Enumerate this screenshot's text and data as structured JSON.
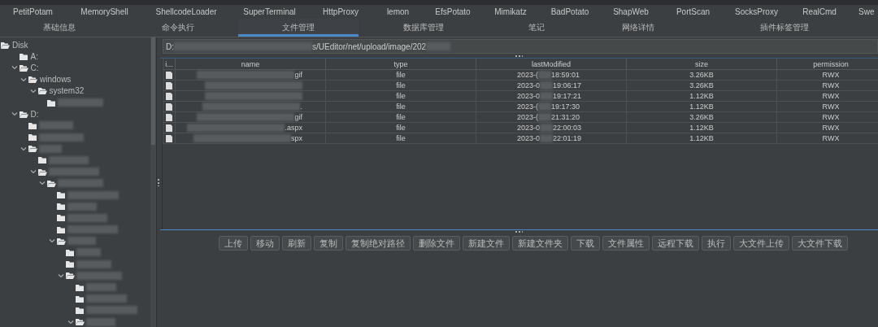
{
  "plugin_menu": [
    "PetitPotam",
    "MemoryShell",
    "ShellcodeLoader",
    "SuperTerminal",
    "HttpProxy",
    "lemon",
    "EfsPotato",
    "Mimikatz",
    "BadPotato",
    "ShapWeb",
    "PortScan",
    "SocksProxy",
    "RealCmd",
    "Swe"
  ],
  "tabs": [
    {
      "label": "基础信息",
      "selected": false
    },
    {
      "label": "命令执行",
      "selected": false
    },
    {
      "label": "文件管理",
      "selected": true
    },
    {
      "label": "数据库管理",
      "selected": false
    },
    {
      "label": "笔记",
      "selected": false
    },
    {
      "label": "网络详情",
      "selected": false
    },
    {
      "label": "插件标签管理",
      "selected": false
    }
  ],
  "tree": [
    {
      "label": "Disk",
      "kind": "root",
      "expanded": true,
      "children": [
        {
          "label": "A:",
          "expanded": false
        },
        {
          "label": "C:",
          "expanded": true,
          "children": [
            {
              "label": "windows",
              "expanded": true,
              "children": [
                {
                  "label": "system32",
                  "expanded": true,
                  "children": [
                    {
                      "expanded": false
                    }
                  ]
                }
              ]
            }
          ]
        },
        {
          "label": "D:",
          "expanded": true,
          "children": [
            {
              "expanded": false
            },
            {
              "expanded": false
            },
            {
              "expanded": true,
              "children": [
                {
                  "expanded": false
                },
                {
                  "expanded": true,
                  "children": [
                    {
                      "expanded": true,
                      "children": [
                        {
                          "expanded": false
                        },
                        {
                          "expanded": false
                        },
                        {
                          "expanded": false
                        },
                        {
                          "expanded": false
                        },
                        {
                          "expanded": true,
                          "children": [
                            {
                              "expanded": false
                            },
                            {
                              "expanded": false
                            },
                            {
                              "expanded": true,
                              "children": [
                                {
                                  "expanded": false
                                },
                                {
                                  "expanded": false
                                },
                                {
                                  "expanded": false
                                },
                                {
                                  "expanded": true
                                }
                              ]
                            }
                          ]
                        }
                      ]
                    }
                  ]
                }
              ]
            }
          ]
        }
      ]
    }
  ],
  "path_start": "D:",
  "path_end": "s/UEditor/net/upload/image/202",
  "table": {
    "columns": [
      "i...",
      "name",
      "type",
      "lastModified",
      "size",
      "permission"
    ],
    "rows": [
      {
        "name": "gif",
        "type": "file",
        "modified_start": "2023-(",
        "modified_end": "18:59:01",
        "size": "3.26KB",
        "permission": "RWX"
      },
      {
        "name": "",
        "type": "file",
        "modified_start": "2023-0",
        "modified_end": "19:06:17",
        "size": "3.26KB",
        "permission": "RWX"
      },
      {
        "name": "",
        "type": "file",
        "modified_start": "2023-0",
        "modified_end": "19:17:21",
        "size": "1.12KB",
        "permission": "RWX"
      },
      {
        "name": ".",
        "type": "file",
        "modified_start": "2023-(",
        "modified_end": "19:17:30",
        "size": "1.12KB",
        "permission": "RWX"
      },
      {
        "name": "gif",
        "type": "file",
        "modified_start": "2023-(",
        "modified_end": "21:31:20",
        "size": "3.26KB",
        "permission": "RWX"
      },
      {
        "name": ".aspx",
        "type": "file",
        "modified_start": "2023-0",
        "modified_end": "22:00:03",
        "size": "1.12KB",
        "permission": "RWX"
      },
      {
        "name": "spx",
        "type": "file",
        "modified_start": "2023-0",
        "modified_end": "22:01:19",
        "size": "1.12KB",
        "permission": "RWX"
      }
    ]
  },
  "buttons": [
    "上传",
    "移动",
    "刷新",
    "复制",
    "复制绝对路径",
    "删除文件",
    "新建文件",
    "新建文件夹",
    "下载",
    "文件属性",
    "远程下载",
    "执行",
    "大文件上传",
    "大文件下载"
  ]
}
